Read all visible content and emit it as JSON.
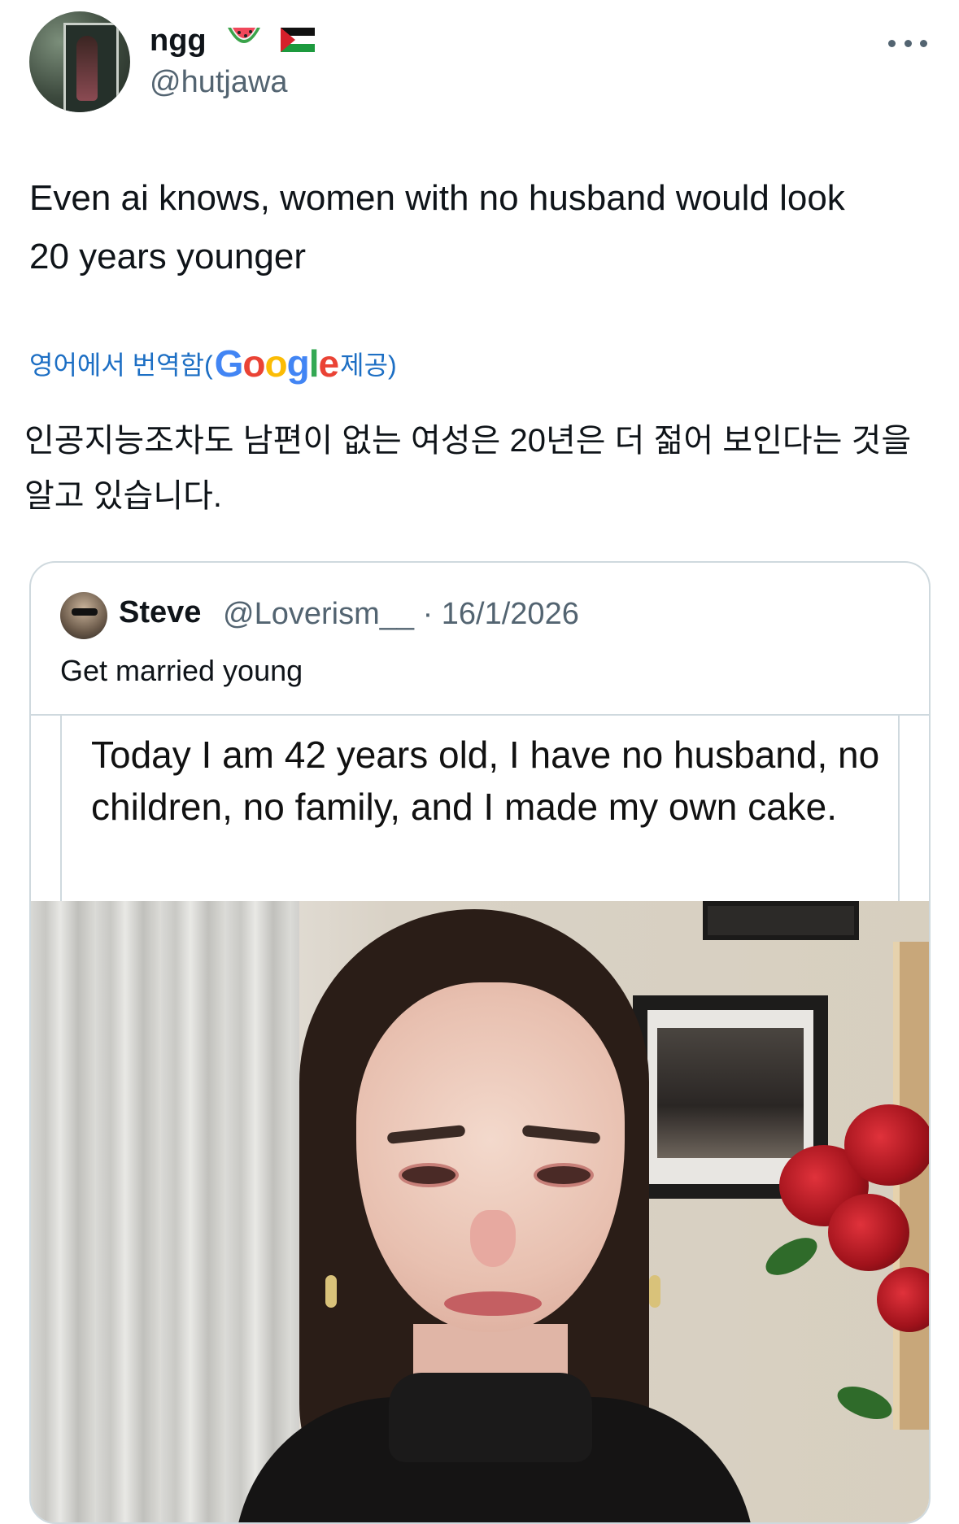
{
  "author": {
    "display_name": "ngg",
    "handle": "@hutjawa",
    "emojis": [
      "watermelon-icon",
      "palestine-flag-icon"
    ]
  },
  "tweet": {
    "text": "Even ai knows, women with no husband would look 20 years younger",
    "translation_label_prefix": "영어에서 번역함(",
    "translation_provider": "Google",
    "translation_label_suffix": " 제공)",
    "translated_text": "인공지능조차도 남편이 없는 여성은 20년은 더 젊어 보인다는 것을 알고 있습니다."
  },
  "quote": {
    "display_name": "Steve",
    "handle": "@Loverism__",
    "separator": "·",
    "date": "16/1/2026",
    "text": "Get married young",
    "media_caption": "Today I am 42 years old, I have no husband, no children, no family, and I made my own cake."
  },
  "colors": {
    "text_primary": "#0f1419",
    "text_secondary": "#536471",
    "link": "#1d6fc4",
    "border": "#cfd9de"
  }
}
